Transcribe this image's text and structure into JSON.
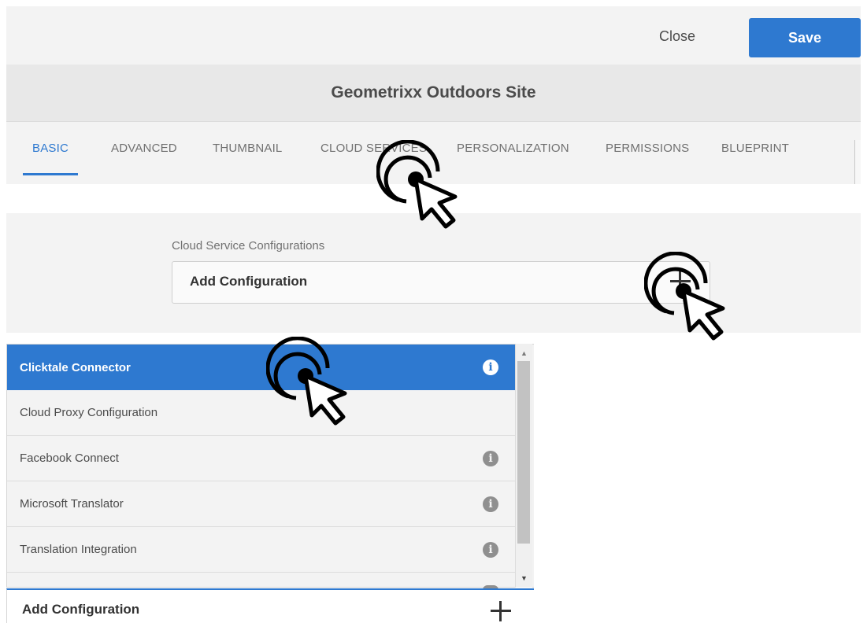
{
  "header": {
    "close_label": "Close",
    "save_label": "Save"
  },
  "dialog": {
    "title": "Geometrixx Outdoors Site"
  },
  "tabs": [
    {
      "label": "BASIC",
      "active": true
    },
    {
      "label": "ADVANCED",
      "active": false
    },
    {
      "label": "THUMBNAIL",
      "active": false
    },
    {
      "label": "CLOUD SERVICES",
      "active": false
    },
    {
      "label": "PERSONALIZATION",
      "active": false
    },
    {
      "label": "PERMISSIONS",
      "active": false
    },
    {
      "label": "BLUEPRINT",
      "active": false
    }
  ],
  "cloud_services": {
    "section_label": "Cloud Service Configurations",
    "field_label": "Add Configuration"
  },
  "dropdown": {
    "items": [
      {
        "label": "Clicktale Connector",
        "selected": true,
        "has_info": true
      },
      {
        "label": "Cloud Proxy Configuration",
        "selected": false,
        "has_info": false
      },
      {
        "label": "Facebook Connect",
        "selected": false,
        "has_info": true
      },
      {
        "label": "Microsoft Translator",
        "selected": false,
        "has_info": true
      },
      {
        "label": "Translation Integration",
        "selected": false,
        "has_info": true
      }
    ],
    "bottom_field_label": "Add Configuration",
    "info_glyph": "i"
  },
  "colors": {
    "accent": "#2e79d0",
    "header_bg": "#f3f3f3",
    "title_bg": "#e8e8e8"
  },
  "icons": [
    "plus-icon",
    "info-icon",
    "click-cursor-icon",
    "scroll-up-arrow",
    "scroll-down-arrow"
  ]
}
